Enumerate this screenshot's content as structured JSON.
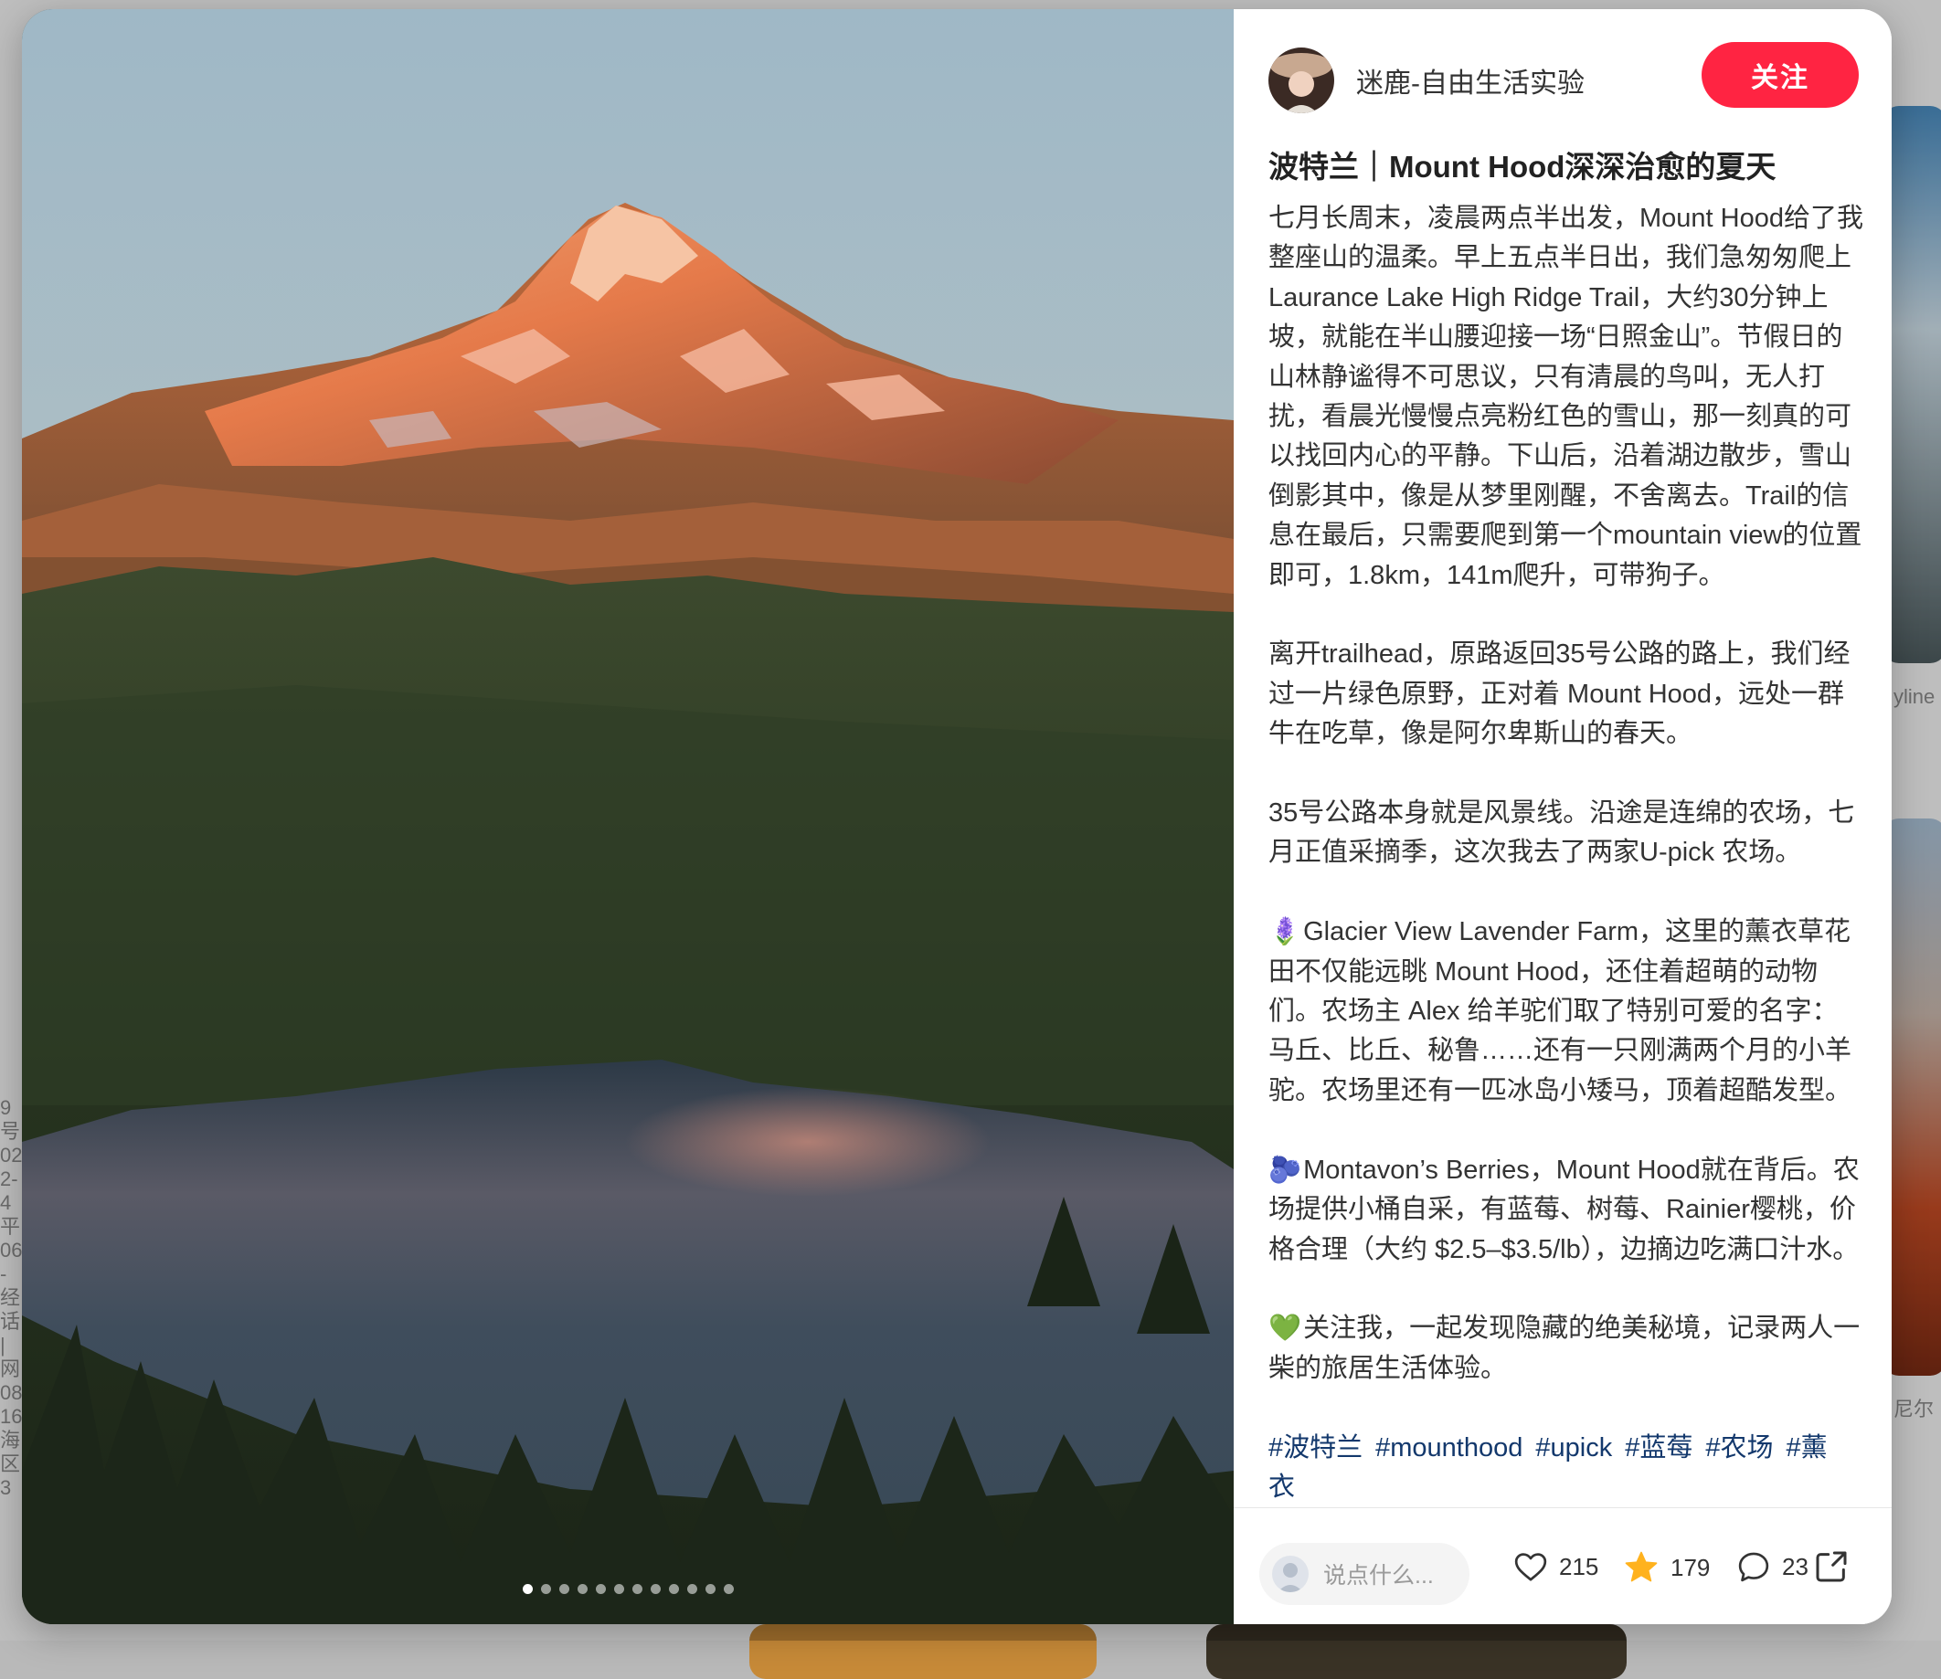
{
  "author": {
    "name": "迷鹿-自由生活实验",
    "follow_label": "关注"
  },
  "note": {
    "title": "波特兰｜Mount Hood深深治愈的夏天",
    "paragraphs": [
      {
        "emoji": "",
        "text": "七月长周末，凌晨两点半出发，Mount Hood给了我整座山的温柔。早上五点半日出，我们急匆匆爬上Laurance Lake High Ridge Trail，大约30分钟上坡，就能在半山腰迎接一场“日照金山”。节假日的山林静谧得不可思议，只有清晨的鸟叫，无人打扰，看晨光慢慢点亮粉红色的雪山，那一刻真的可以找回内心的平静。下山后，沿着湖边散步，雪山倒影其中，像是从梦里刚醒，不舍离去。Trail的信息在最后，只需要爬到第一个mountain view的位置即可，1.8km，141m爬升，可带狗子。"
      },
      {
        "emoji": "",
        "text": "离开trailhead，原路返回35号公路的路上，我们经过一片绿色原野，正对着 Mount Hood，远处一群牛在吃草，像是阿尔卑斯山的春天。"
      },
      {
        "emoji": "",
        "text": "35号公路本身就是风景线。沿途是连绵的农场，七月正值采摘季，这次我去了两家U-pick 农场。"
      },
      {
        "emoji": "🪻",
        "text": "Glacier View Lavender Farm，这里的薰衣草花田不仅能远眺 Mount Hood，还住着超萌的动物们。农场主 Alex 给羊驼们取了特别可爱的名字：马丘、比丘、秘鲁……还有一只刚满两个月的小羊驼。农场里还有一匹冰岛小矮马，顶着超酷发型。"
      },
      {
        "emoji": "🫐",
        "text": "Montavon’s Berries，Mount Hood就在背后。农场提供小桶自采，有蓝莓、树莓、Rainier樱桃，价格合理（大约 $2.5–$3.5/lb），边摘边吃满口汁水。"
      },
      {
        "emoji": "💚",
        "text": "关注我，一起发现隐藏的绝美秘境，记录两人一柴的旅居生活体验。"
      }
    ],
    "tags": [
      "#波特兰",
      "#mounthood",
      "#upick",
      "#蓝莓",
      "#农场",
      "#薰衣"
    ]
  },
  "bottom_bar": {
    "comment_placeholder": "说点什么...",
    "likes": "215",
    "collects": "179",
    "comments": "23"
  },
  "carousel": {
    "total": 12,
    "active": 0
  },
  "background": {
    "left_fragments": [
      "9号",
      "02",
      "2-4",
      "平",
      "06",
      "-经",
      "话",
      "|",
      "网",
      "08",
      "16",
      "海",
      "区",
      "3"
    ],
    "right_fragments": [
      "yline",
      "尼尔"
    ]
  },
  "colors": {
    "accent": "#ff2442",
    "tag": "#13386c",
    "star": "#ffb21e"
  },
  "icons": [
    "heart-icon",
    "star-icon",
    "comment-icon",
    "share-icon"
  ]
}
